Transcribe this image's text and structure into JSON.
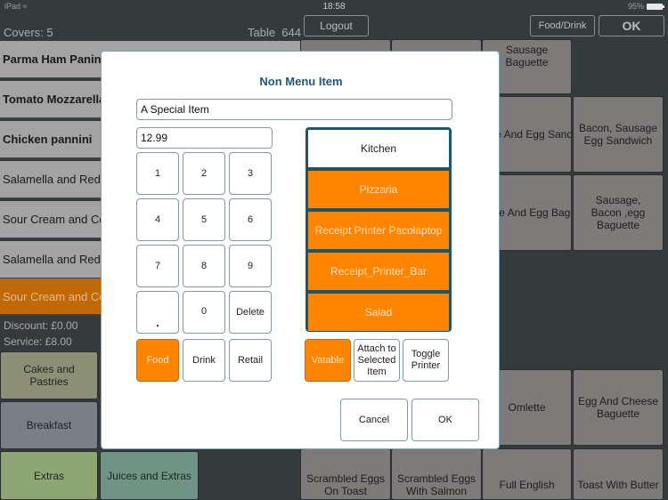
{
  "status_bar": {
    "device": "iPad",
    "wifi_icon": "wifi-icon",
    "time": "18:58",
    "battery": "95%",
    "battery_level": 0.95
  },
  "header": {
    "covers": "Covers: 5",
    "table": "Table  644",
    "logout_label": "Logout",
    "food_drink_label": "Food/Drink",
    "ok_label": "OK"
  },
  "order": {
    "items": [
      {
        "label": "Parma Ham Panini",
        "bold": true,
        "selected": false
      },
      {
        "label": "Tomato Mozzarella",
        "bold": true,
        "selected": false
      },
      {
        "label": "Chicken pannini",
        "bold": true,
        "selected": false
      },
      {
        "label": "Salamella and Red",
        "bold": false,
        "selected": false
      },
      {
        "label": "Sour Cream and Co",
        "bold": false,
        "selected": false
      },
      {
        "label": "Salamella and Red",
        "bold": false,
        "selected": false
      },
      {
        "label": "Sour Cream and Co",
        "bold": false,
        "selected": true
      }
    ],
    "discount": "Discount: £0.00",
    "service": "Service: £8.00"
  },
  "categories": [
    {
      "label": "Cakes and Pastries",
      "color": "#8c8f74"
    },
    {
      "label": "Breakfast",
      "color": "#7a7e86"
    },
    {
      "label": "Extras",
      "color": "#8ea673"
    },
    {
      "label": "Juices and Extras",
      "color": "#6f9384"
    }
  ],
  "menu_tiles": {
    "sausage_baguette": "Sausage Baguette",
    "sausage_egg_sandwich": "Sausage And Egg Sandwich",
    "bacon_sausage_egg_sandwich": "Bacon, Sausage Egg Sandwich",
    "sausage_egg_baguette": "Sausage And Egg Baguette",
    "sausage_bacon_egg_baguette": "Sausage, Bacon ,egg Baguette",
    "omlette": "Omlette",
    "egg_cheese_baguette": "Egg And Cheese Baguette",
    "scrambled_toast": "Scrambled Eggs On Toast",
    "scrambled_salmon": "Scrambled Eggs With Salmon",
    "full_english": "Full English",
    "toast_butter": "Toast With Butter"
  },
  "dialog": {
    "title": "Non Menu Item",
    "name_value": "A Special Item",
    "price_value": "12.99",
    "keypad": [
      "1",
      "2",
      "3",
      "4",
      "5",
      "6",
      "7",
      "8",
      "9",
      ".",
      "0",
      "Delete"
    ],
    "types": [
      {
        "label": "Food",
        "active": true
      },
      {
        "label": "Drink",
        "active": false
      },
      {
        "label": "Retail",
        "active": false
      }
    ],
    "printers": [
      {
        "label": "Kitchen",
        "active": false
      },
      {
        "label": "Pizzaria",
        "active": true
      },
      {
        "label": "Receipt Printer Pacolaptop",
        "active": true
      },
      {
        "label": "Receipt_Printer_Bar",
        "active": true
      },
      {
        "label": "Salad",
        "active": true
      }
    ],
    "options": [
      {
        "label": "Vatable",
        "active": true
      },
      {
        "label": "Attach to Selected Item",
        "active": false
      },
      {
        "label": "Toggle Printer",
        "active": false
      }
    ],
    "cancel_label": "Cancel",
    "ok_label": "OK"
  },
  "colors": {
    "accent": "#ff8400",
    "title_blue": "#1b5a78",
    "selected_order": "#c06908",
    "background": "#343b3d"
  }
}
